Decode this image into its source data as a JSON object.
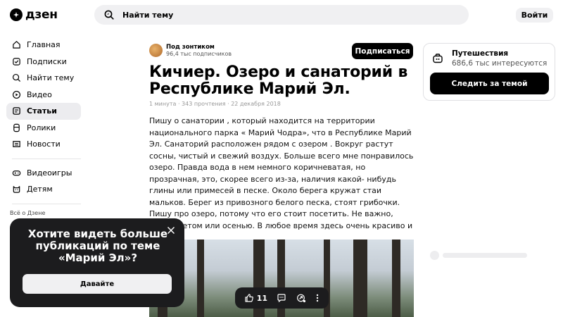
{
  "header": {
    "logo_text": "дзен",
    "search_placeholder": "Найти тему",
    "login_label": "Войти"
  },
  "sidebar": {
    "items": [
      {
        "label": "Главная",
        "icon": "home-icon"
      },
      {
        "label": "Подписки",
        "icon": "subscriptions-icon"
      },
      {
        "label": "Найти тему",
        "icon": "find-topic-icon"
      },
      {
        "label": "Видео",
        "icon": "video-icon"
      },
      {
        "label": "Статьи",
        "icon": "articles-icon"
      },
      {
        "label": "Ролики",
        "icon": "shorts-icon"
      },
      {
        "label": "Новости",
        "icon": "news-icon"
      },
      {
        "label": "Видеоигры",
        "icon": "gamepad-icon"
      },
      {
        "label": "Детям",
        "icon": "kids-icon"
      }
    ],
    "active_item": "Статьи",
    "footer_link": "Всё о Дзене"
  },
  "article": {
    "author_name": "Под зонтиком",
    "author_subscribers": "96,4 тыс подписчиков",
    "subscribe_label": "Подписаться",
    "title": "Кичиер. Озеро и санаторий в Республике Марий Эл.",
    "meta": "1 минута · 343 прочтения · 22 декабря 2018",
    "body": "Пишу о санатории , который находится на территории национального парка « Марий Чодра», что в Республике Марий Эл. Санаторий расположен рядом с озером . Вокруг растут сосны, чистый и свежий воздух. Больше всего мне понравилось озеро. Правда вода в нем немного коричневатая, но прозрачная, это, скорее всего из-за, наличия какой- нибудь глины или примесей в песке. Около берега кружат стаи мальков. Берег из привозного белого песка, стоят грибочки. Пишу про озеро, потому что его стоит посетить. Не важно, когда, летом или осенью. В любое время здесь очень красиво и"
  },
  "actions": {
    "like_count": "11"
  },
  "topic_card": {
    "title": "Путешествия",
    "count": "686,6 тыс интересуются",
    "follow_label": "Следить за темой"
  },
  "popup": {
    "text": "Хотите видеть больше публикаций по теме «Марий Эл»?",
    "button_label": "Давайте"
  }
}
